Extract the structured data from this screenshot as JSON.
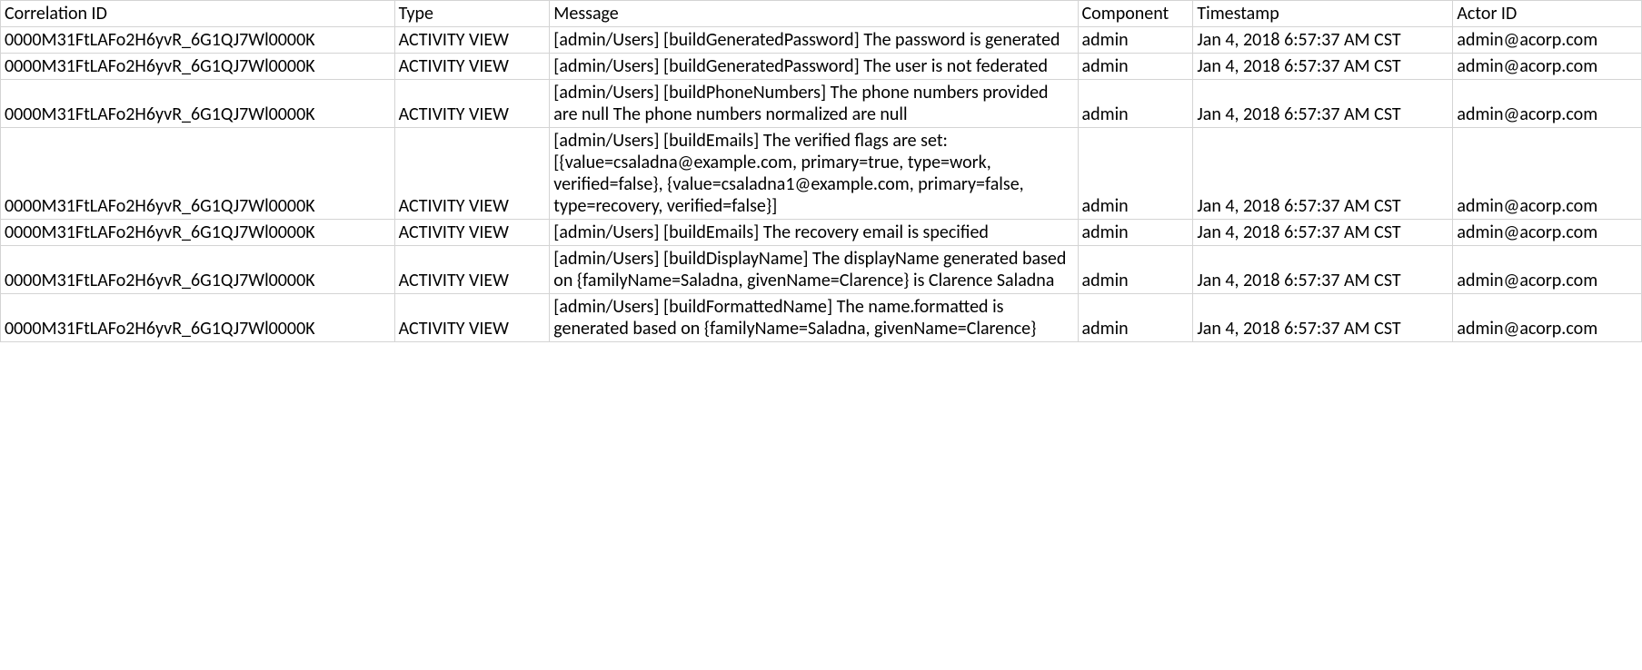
{
  "headers": {
    "correlation": "Correlation ID",
    "type": "Type",
    "message": "Message",
    "component": "Component",
    "timestamp": "Timestamp",
    "actor": "Actor ID"
  },
  "rows": [
    {
      "correlation": "0000M31FtLAFo2H6yvR_6G1QJ7Wl0000K",
      "type": "ACTIVITY VIEW",
      "message": "[admin/Users] [buildGeneratedPassword] The password is generated",
      "component": "admin",
      "timestamp": "Jan 4, 2018 6:57:37 AM CST",
      "actor": "admin@acorp.com"
    },
    {
      "correlation": "0000M31FtLAFo2H6yvR_6G1QJ7Wl0000K",
      "type": "ACTIVITY VIEW",
      "message": "[admin/Users] [buildGeneratedPassword] The user is not federated",
      "component": "admin",
      "timestamp": "Jan 4, 2018 6:57:37 AM CST",
      "actor": "admin@acorp.com"
    },
    {
      "correlation": "0000M31FtLAFo2H6yvR_6G1QJ7Wl0000K",
      "type": "ACTIVITY VIEW",
      "message": "[admin/Users] [buildPhoneNumbers] The phone numbers provided are null The phone numbers normalized are null",
      "component": "admin",
      "timestamp": "Jan 4, 2018 6:57:37 AM CST",
      "actor": "admin@acorp.com"
    },
    {
      "correlation": "0000M31FtLAFo2H6yvR_6G1QJ7Wl0000K",
      "type": "ACTIVITY VIEW",
      "message": "[admin/Users] [buildEmails] The verified flags are set: [{value=csaladna@example.com, primary=true, type=work, verified=false}, {value=csaladna1@example.com, primary=false, type=recovery, verified=false}]",
      "component": "admin",
      "timestamp": "Jan 4, 2018 6:57:37 AM CST",
      "actor": "admin@acorp.com"
    },
    {
      "correlation": "0000M31FtLAFo2H6yvR_6G1QJ7Wl0000K",
      "type": "ACTIVITY VIEW",
      "message": "[admin/Users] [buildEmails] The recovery email is specified",
      "component": "admin",
      "timestamp": "Jan 4, 2018 6:57:37 AM CST",
      "actor": "admin@acorp.com"
    },
    {
      "correlation": "0000M31FtLAFo2H6yvR_6G1QJ7Wl0000K",
      "type": "ACTIVITY VIEW",
      "message": "[admin/Users] [buildDisplayName] The displayName generated based on {familyName=Saladna, givenName=Clarence} is Clarence Saladna",
      "component": "admin",
      "timestamp": "Jan 4, 2018 6:57:37 AM CST",
      "actor": "admin@acorp.com"
    },
    {
      "correlation": "0000M31FtLAFo2H6yvR_6G1QJ7Wl0000K",
      "type": "ACTIVITY VIEW",
      "message": "[admin/Users] [buildFormattedName] The name.formatted is generated based on {familyName=Saladna, givenName=Clarence}",
      "component": "admin",
      "timestamp": "Jan 4, 2018 6:57:37 AM CST",
      "actor": "admin@acorp.com"
    }
  ]
}
